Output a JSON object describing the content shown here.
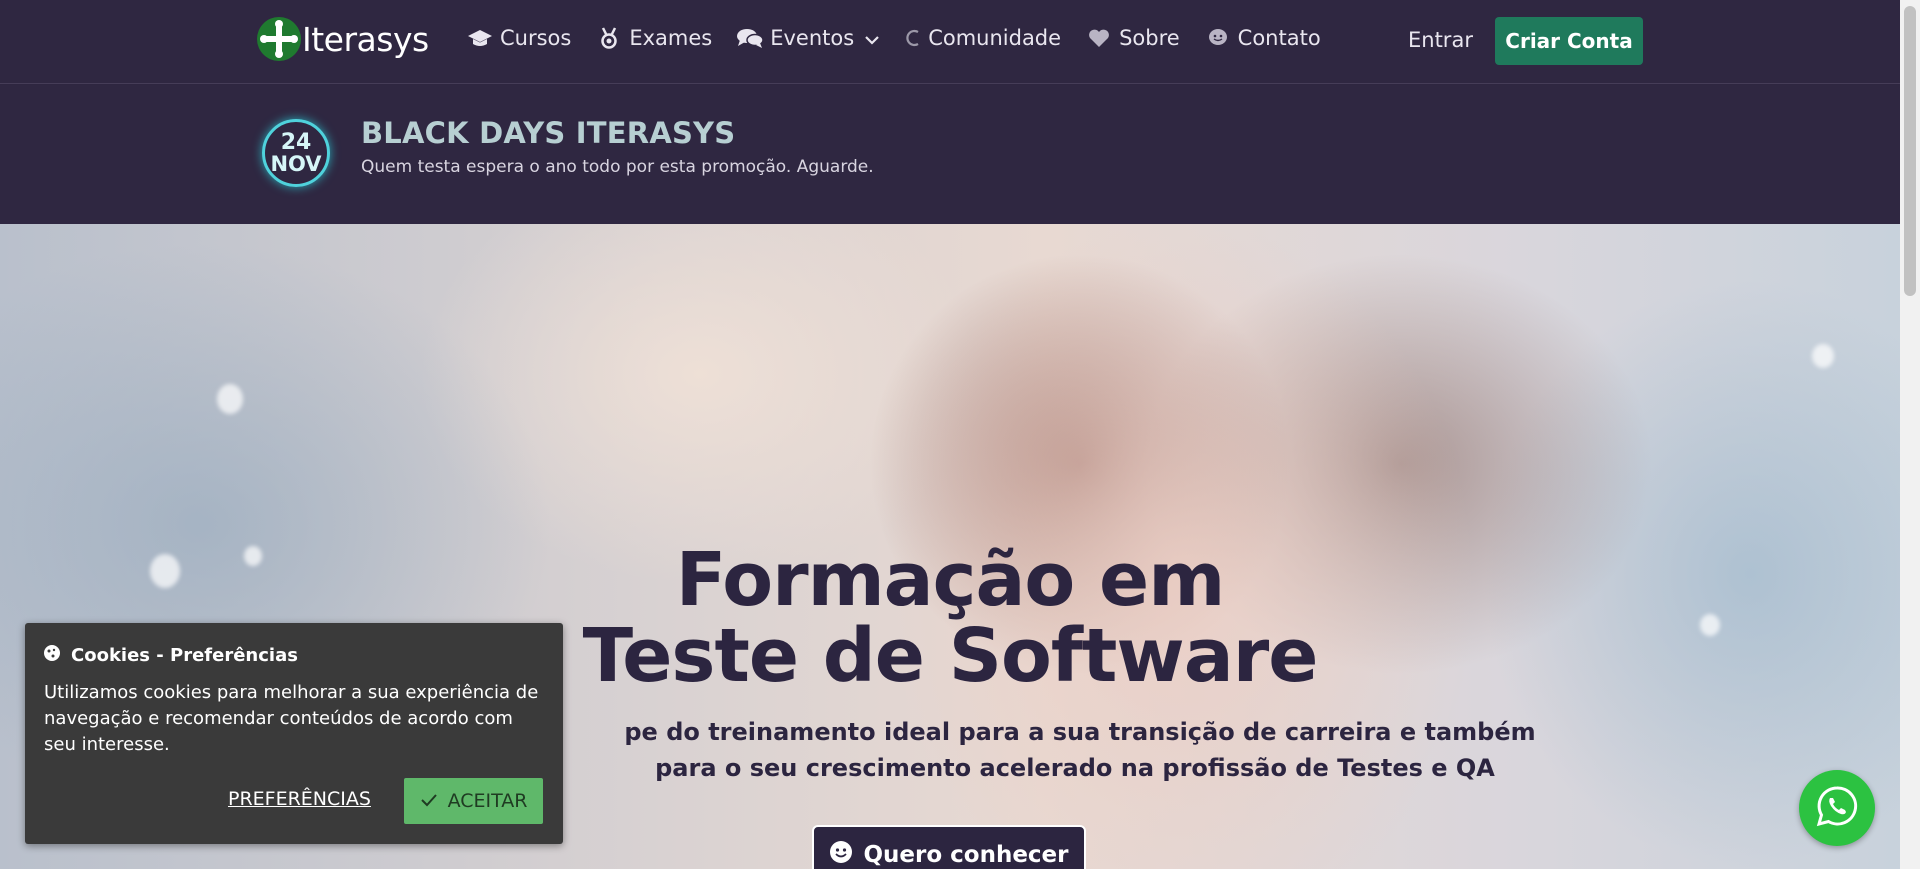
{
  "nav": {
    "brand": "Iterasys",
    "items": [
      {
        "label": "Cursos",
        "icon": "graduation-cap-icon"
      },
      {
        "label": "Exames",
        "icon": "medal-icon"
      },
      {
        "label": "Eventos",
        "icon": "chat-bubbles-icon",
        "dropdown": true
      },
      {
        "label": "Comunidade",
        "icon": "loading-arc-icon"
      },
      {
        "label": "Sobre",
        "icon": "heart-icon"
      },
      {
        "label": "Contato",
        "icon": "smile-bubble-icon"
      }
    ],
    "login_label": "Entrar",
    "signup_label": "Criar Conta"
  },
  "promo": {
    "badge_day": "24",
    "badge_month": "NOV",
    "title": "BLACK DAYS ITERASYS",
    "subtitle": "Quem testa espera o ano todo por esta promoção. Aguarde."
  },
  "hero": {
    "title_line1": "Formação em",
    "title_line2": "Teste de Software",
    "subtitle_line1": "pe do treinamento ideal para a sua transição de carreira e também",
    "subtitle_line2": "para o seu crescimento acelerado na profissão de Testes e QA",
    "cta_label": "Quero conhecer"
  },
  "cookie": {
    "title": "Cookies - Preferências",
    "text": "Utilizamos cookies para melhorar a sua experiência de navegação e recomendar conteúdos de acordo com seu interesse.",
    "preferences_label": "PREFERÊNCIAS",
    "accept_label": "ACEITAR"
  },
  "colors": {
    "nav_bg": "#2f2741",
    "brand_green": "#1f7a5c",
    "hero_text": "#2c2540",
    "accept_green": "#5fb86a",
    "whatsapp_green": "#2cc241"
  }
}
